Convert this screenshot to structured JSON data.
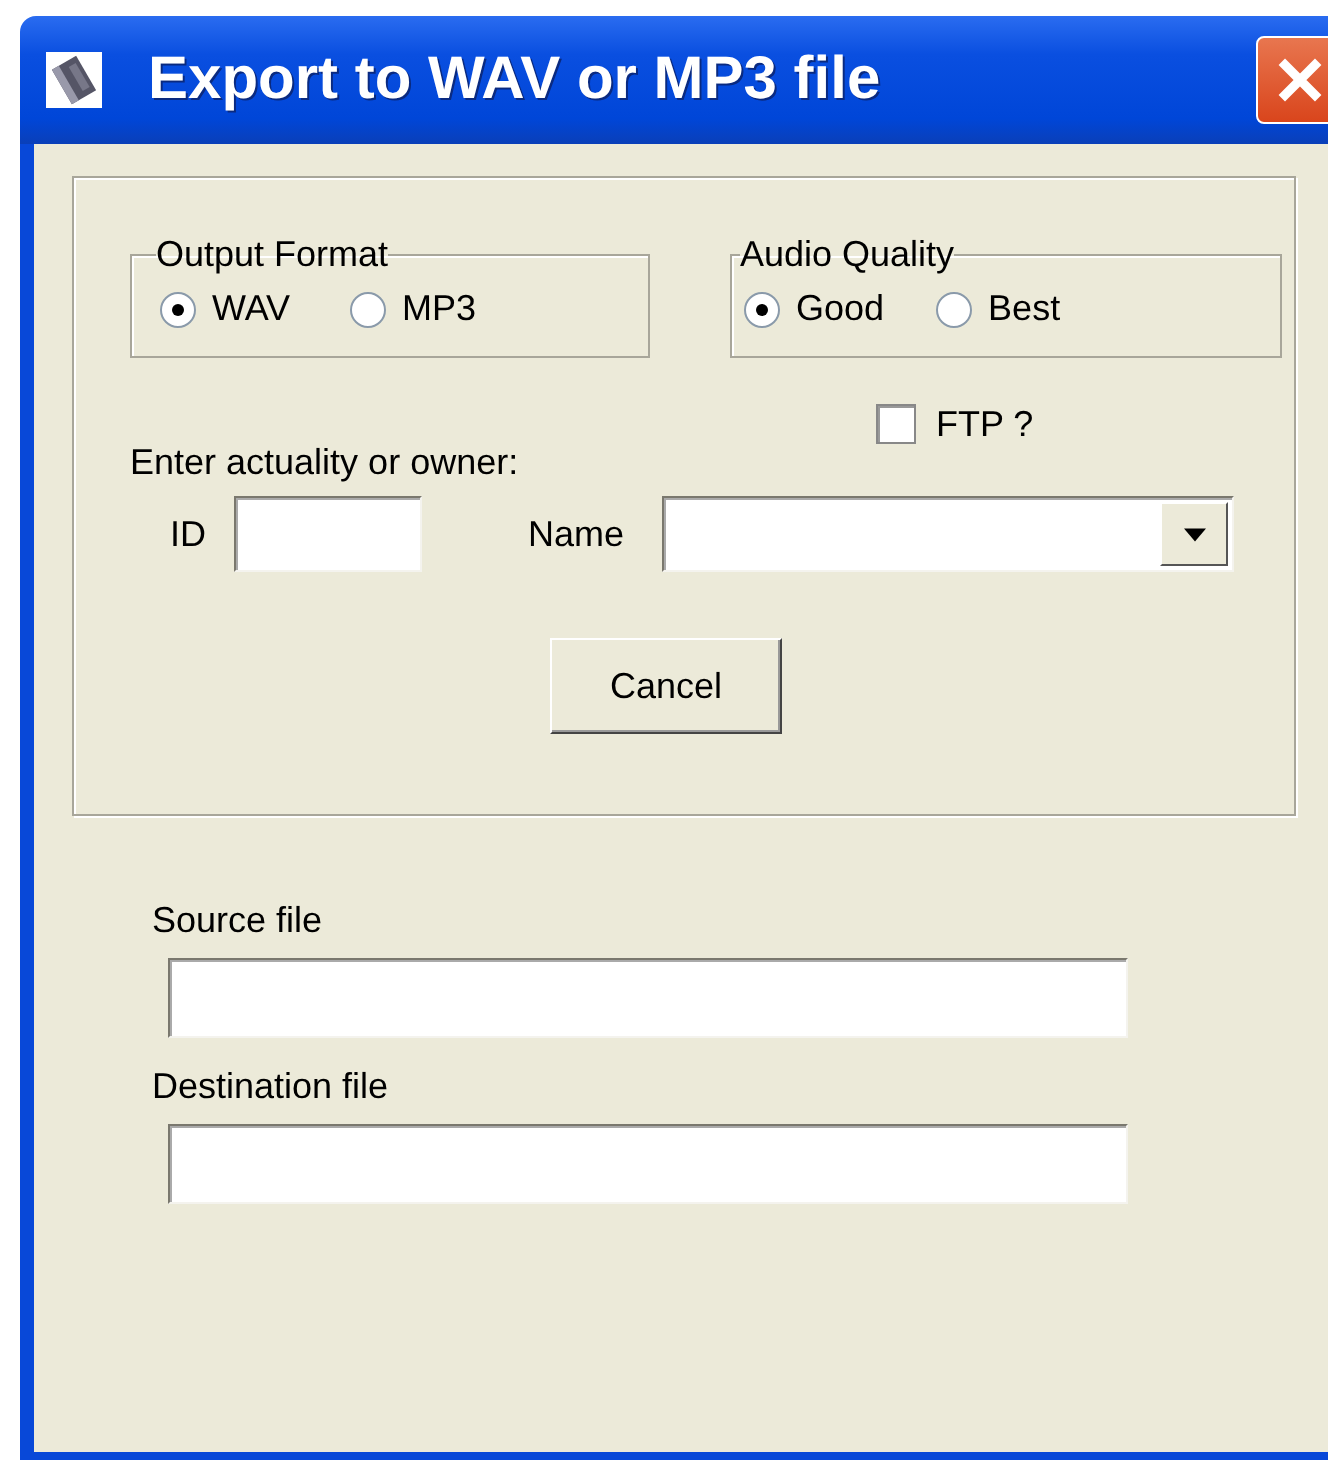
{
  "window": {
    "title": "Export to WAV or MP3 file"
  },
  "output_format": {
    "label": "Output Format",
    "options": [
      {
        "label": "WAV",
        "selected": true
      },
      {
        "label": "MP3",
        "selected": false
      }
    ]
  },
  "audio_quality": {
    "label": "Audio Quality",
    "options": [
      {
        "label": "Good",
        "selected": true
      },
      {
        "label": "Best",
        "selected": false
      }
    ]
  },
  "ftp": {
    "label": "FTP ?",
    "checked": false
  },
  "prompt": "Enter actuality or owner:",
  "id_field": {
    "label": "ID"
  },
  "name_field": {
    "label": "Name"
  },
  "cancel_button": "Cancel",
  "source_file": {
    "label": "Source file"
  },
  "destination_file": {
    "label": "Destination file"
  }
}
